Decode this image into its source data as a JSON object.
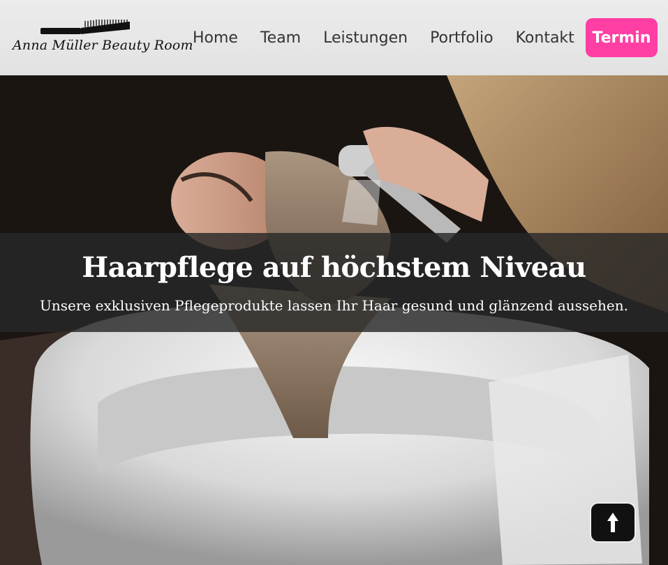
{
  "header": {
    "logo_text": "Anna Müller Beauty Room",
    "logo_icon": "comb-icon",
    "nav": [
      {
        "label": "Home"
      },
      {
        "label": "Team"
      },
      {
        "label": "Leistungen"
      },
      {
        "label": "Portfolio"
      },
      {
        "label": "Kontakt"
      }
    ],
    "cta_label": "Termin",
    "cta_color": "#ff3fa4"
  },
  "hero": {
    "image_subject": "hair-wash-photo",
    "title": "Haarpflege auf höchstem Niveau",
    "subtitle": "Unsere exklusiven Pflegeprodukte lassen Ihr Haar gesund und glänzend aussehen."
  },
  "scroll_top": {
    "icon": "arrow-up-icon"
  }
}
